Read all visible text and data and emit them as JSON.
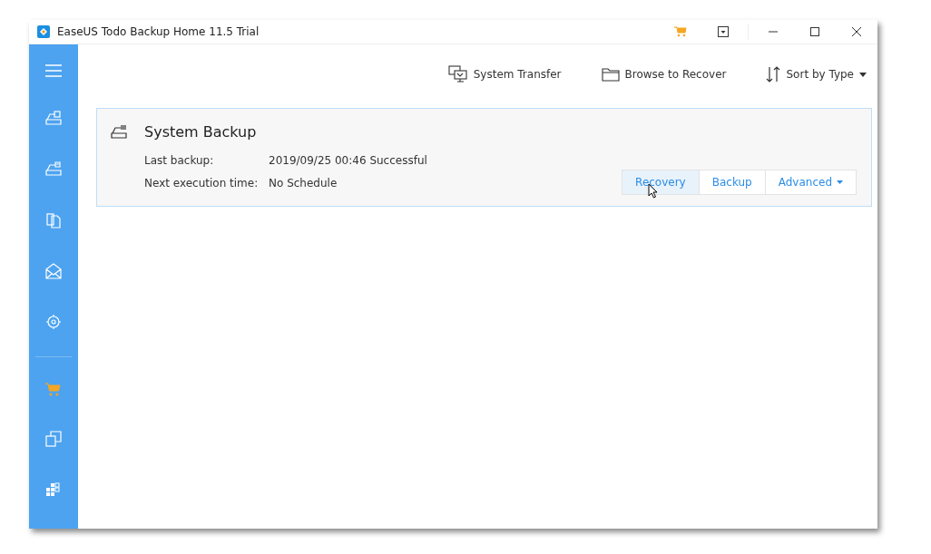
{
  "window": {
    "title": "EaseUS Todo Backup Home 11.5 Trial"
  },
  "toolbar": [
    {
      "kind": "transfer",
      "label": "System Transfer"
    },
    {
      "kind": "folder",
      "label": "Browse to Recover"
    },
    {
      "kind": "sort",
      "label": "Sort by Type",
      "dropdown": true
    }
  ],
  "backup_card": {
    "title": "System Backup",
    "details": [
      {
        "label": "Last backup:",
        "value": "2019/09/25 00:46 Successful"
      },
      {
        "label": "Next execution time:",
        "value": "No Schedule"
      }
    ],
    "buttons": [
      {
        "label": "Recovery",
        "hovered": true,
        "dropdown": false
      },
      {
        "label": "Backup",
        "hovered": false,
        "dropdown": false
      },
      {
        "label": "Advanced",
        "hovered": false,
        "dropdown": true
      }
    ]
  }
}
